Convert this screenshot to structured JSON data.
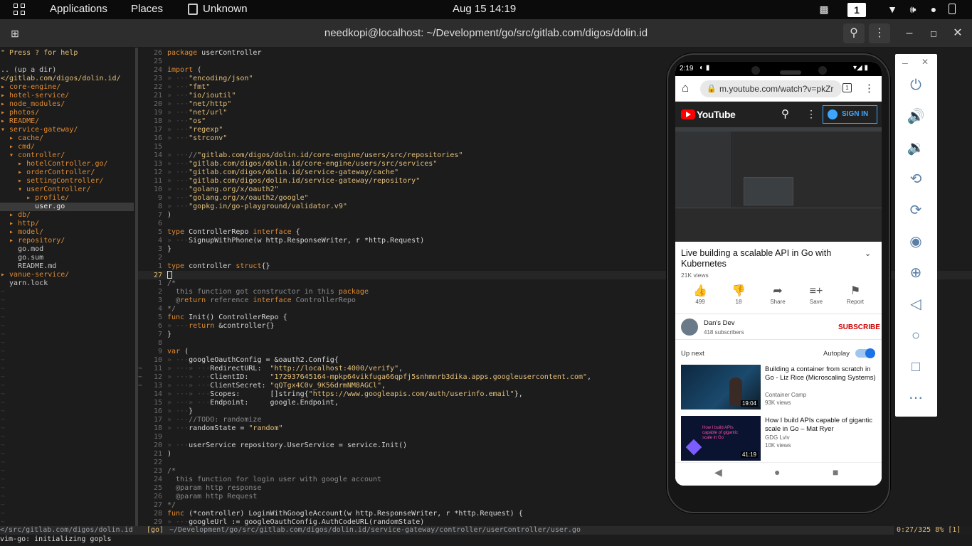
{
  "topbar": {
    "applications": "Applications",
    "places": "Places",
    "active_app": "Unknown",
    "clock": "Aug 15  14:19",
    "workspace": "1"
  },
  "terminal": {
    "title": "needkopi@localhost: ~/Development/go/src/gitlab.com/digos/dolin.id"
  },
  "tree": {
    "lines": [
      "\" Press ? for help",
      "",
      ".. (up a dir)",
      "</gitlab.com/digos/dolin.id/",
      "▸ core-engine/",
      "▸ hotel-service/",
      "▸ node_modules/",
      "▸ photos/",
      "▸ README/",
      "▾ service-gateway/",
      "  ▸ cache/",
      "  ▸ cmd/",
      "  ▾ controller/",
      "    ▸ hotelController.go/",
      "    ▸ orderController/",
      "    ▸ settingController/",
      "    ▾ userController/",
      "      ▸ profile/",
      "        user.go",
      "  ▸ db/",
      "  ▸ http/",
      "  ▸ model/",
      "  ▸ repository/",
      "    go.mod",
      "    go.sum",
      "    README.md",
      "▸ vanue-service/",
      "  yarn.lock"
    ],
    "selected_index": 18
  },
  "code": {
    "lines": [
      {
        "n": "26",
        "t": "package userController"
      },
      {
        "n": "25",
        "t": ""
      },
      {
        "n": "24",
        "t": "import ("
      },
      {
        "n": "23",
        "t": "» ···\"encoding/json\""
      },
      {
        "n": "22",
        "t": "» ···\"fmt\""
      },
      {
        "n": "21",
        "t": "» ···\"io/ioutil\""
      },
      {
        "n": "20",
        "t": "» ···\"net/http\""
      },
      {
        "n": "19",
        "t": "» ···\"net/url\""
      },
      {
        "n": "18",
        "t": "» ···\"os\""
      },
      {
        "n": "17",
        "t": "» ···\"regexp\""
      },
      {
        "n": "16",
        "t": "» ···\"strconv\""
      },
      {
        "n": "15",
        "t": ""
      },
      {
        "n": "14",
        "t": "» ···//\"gitlab.com/digos/dolin.id/core-engine/users/src/repositories\""
      },
      {
        "n": "13",
        "t": "» ···\"gitlab.com/digos/dolin.id/core-engine/users/src/services\""
      },
      {
        "n": "12",
        "t": "» ···\"gitlab.com/digos/dolin.id/service-gateway/cache\""
      },
      {
        "n": "11",
        "t": "» ···\"gitlab.com/digos/dolin.id/service-gateway/repository\""
      },
      {
        "n": "10",
        "t": "» ···\"golang.org/x/oauth2\""
      },
      {
        "n": "9",
        "t": "» ···\"golang.org/x/oauth2/google\""
      },
      {
        "n": "8",
        "t": "» ···\"gopkg.in/go-playground/validator.v9\""
      },
      {
        "n": "7",
        "t": ")"
      },
      {
        "n": "6",
        "t": ""
      },
      {
        "n": "5",
        "t": "type ControllerRepo interface {"
      },
      {
        "n": "4",
        "t": "» ···SignupWithPhone(w http.ResponseWriter, r *http.Request)"
      },
      {
        "n": "3",
        "t": "}"
      },
      {
        "n": "2",
        "t": ""
      },
      {
        "n": "1",
        "t": "type controller struct{}"
      },
      {
        "n": "27",
        "t": "",
        "cursor": true
      },
      {
        "n": "1",
        "t": "/*"
      },
      {
        "n": "2",
        "t": "  this function got constructor in this package"
      },
      {
        "n": "3",
        "t": "  @return reference interface ControllerRepo"
      },
      {
        "n": "4",
        "t": "*/"
      },
      {
        "n": "5",
        "t": "func Init() ControllerRepo {"
      },
      {
        "n": "6",
        "t": "» ···return &controller{}"
      },
      {
        "n": "7",
        "t": "}"
      },
      {
        "n": "8",
        "t": ""
      },
      {
        "n": "9",
        "t": "var ("
      },
      {
        "n": "10",
        "t": "» ···googleOauthConfig = &oauth2.Config{"
      },
      {
        "n": "11",
        "s": "~",
        "t": "» ···» ···RedirectURL:  \"http://localhost:4000/verify\","
      },
      {
        "n": "12",
        "s": "~",
        "t": "» ···» ···ClientID:     \"172937645164-mpkp64vikfuga66qpfj5snhmnrb3dika.apps.googleusercontent.com\","
      },
      {
        "n": "13",
        "s": "~",
        "t": "» ···» ···ClientSecret: \"qQTgx4C0v_9K56drmNM8AGCl\","
      },
      {
        "n": "14",
        "t": "» ···» ···Scopes:       []string{\"https://www.googleapis.com/auth/userinfo.email\"},"
      },
      {
        "n": "15",
        "t": "» ···» ···Endpoint:     google.Endpoint,"
      },
      {
        "n": "16",
        "t": "» ···}"
      },
      {
        "n": "17",
        "t": "» ···//TODO: randomize"
      },
      {
        "n": "18",
        "t": "» ···randomState = \"random\""
      },
      {
        "n": "19",
        "t": ""
      },
      {
        "n": "20",
        "t": "» ···userService repository.UserService = service.Init()"
      },
      {
        "n": "21",
        "t": ")"
      },
      {
        "n": "22",
        "t": ""
      },
      {
        "n": "23",
        "t": "/*"
      },
      {
        "n": "24",
        "t": "  this function for login user with google account"
      },
      {
        "n": "25",
        "t": "  @param http response"
      },
      {
        "n": "26",
        "t": "  @param http Request"
      },
      {
        "n": "27",
        "t": "*/"
      },
      {
        "n": "28",
        "t": "func (*controller) LoginWithGoogleAccount(w http.ResponseWriter, r *http.Request) {"
      },
      {
        "n": "29",
        "t": "» ···googleUrl := googleOauthConfig.AuthCodeURL(randomState)"
      }
    ]
  },
  "status": {
    "tree_path": "</src/gitlab.com/digos/dolin.id",
    "mode": "[go]",
    "file_path": "~/Development/go/src/gitlab.com/digos/dolin.id/service-gateway/controller/userController/user.go",
    "position": "0:27/325 8% [1]",
    "message": "vim-go: initializing gopls"
  },
  "phone": {
    "time": "2:19",
    "url": "m.youtube.com/watch?v=pkZr",
    "youtube_logo": "YouTube",
    "sign_in": "SIGN IN",
    "video_title": "Live building a scalable API in Go with Kubernetes",
    "views": "21K views",
    "actions": [
      {
        "icon": "thumbs-up-icon",
        "label": "499"
      },
      {
        "icon": "thumbs-down-icon",
        "label": "18"
      },
      {
        "icon": "share-icon",
        "label": "Share"
      },
      {
        "icon": "save-icon",
        "label": "Save"
      },
      {
        "icon": "report-icon",
        "label": "Report"
      }
    ],
    "channel_name": "Dan's Dev",
    "subscribers": "418 subscribers",
    "subscribe": "SUBSCRIBE",
    "up_next": "Up next",
    "autoplay": "Autoplay",
    "recommendations": [
      {
        "title": "Building a container from scratch in Go - Liz Rice (Microscaling Systems)",
        "channel": "Container Camp",
        "views": "93K views",
        "duration": "19:04"
      },
      {
        "title": "How I build APIs capable of gigantic scale in Go – Mat Ryer",
        "channel": "GDG Lviv",
        "views": "10K views",
        "duration": "41:19",
        "thumb_text": "How I build APIs capable of gigantic scale in Go"
      }
    ]
  },
  "colors": {
    "keyword": "#e5c07b",
    "string": "#e5c07b",
    "youtube_red": "#ff0000",
    "subscribe_red": "#cc0000",
    "link_blue": "#3ea6ff",
    "toolbar_icon": "#5a7ea4"
  },
  "emulator_toolbar": {
    "buttons": [
      "power-icon",
      "volume-up-icon",
      "volume-down-icon",
      "rotate-left-icon",
      "rotate-right-icon",
      "camera-icon",
      "zoom-icon",
      "back-icon",
      "home-icon",
      "overview-icon",
      "more-icon"
    ]
  }
}
